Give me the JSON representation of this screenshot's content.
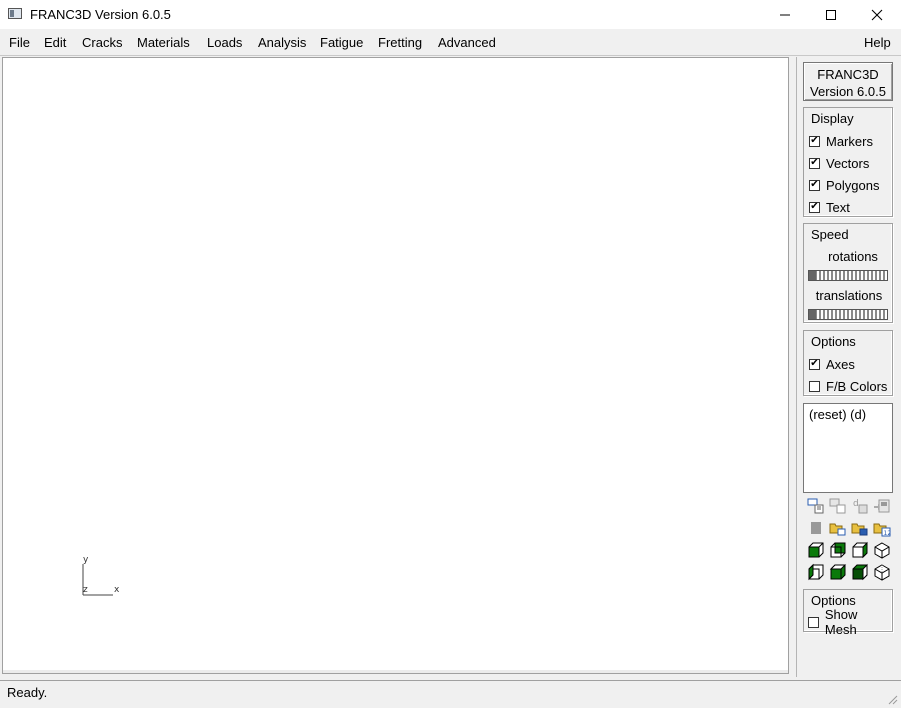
{
  "window": {
    "title": "FRANC3D Version 6.0.5",
    "minimize_glyph": "—",
    "maximize_glyph": "☐",
    "close_glyph": "✕"
  },
  "menu": {
    "items": [
      "File",
      "Edit",
      "Cracks",
      "Materials",
      "Loads",
      "Analysis",
      "Fatigue",
      "Fretting",
      "Advanced"
    ],
    "help": "Help"
  },
  "viewport": {
    "axes": {
      "y": "y",
      "z": "z",
      "x": "x"
    }
  },
  "panel": {
    "version_line1": "FRANC3D",
    "version_line2": "Version 6.0.5",
    "display": {
      "title": "Display",
      "items": [
        {
          "label": "Markers",
          "checked": true
        },
        {
          "label": "Vectors",
          "checked": true
        },
        {
          "label": "Polygons",
          "checked": true
        },
        {
          "label": "Text",
          "checked": true
        }
      ]
    },
    "speed": {
      "title": "Speed",
      "rotations_label": "rotations",
      "translations_label": "translations"
    },
    "options": {
      "title": "Options",
      "items": [
        {
          "label": "Axes",
          "checked": true
        },
        {
          "label": "F/B Colors",
          "checked": false
        }
      ]
    },
    "command_list": {
      "text": "(reset) (d)"
    },
    "tool_icons": [
      "view-transfer-icon",
      "view-copy-icon",
      "view-paste-icon",
      "view-save-icon",
      "disabled-icon",
      "folder-open-icon",
      "folder-load-icon",
      "folder-numbered-icon",
      "cube-front-icon",
      "cube-back-icon",
      "cube-right-icon",
      "cube-iso-icon",
      "cube-left-icon",
      "cube-top-icon",
      "cube-bottom-icon",
      "cube-wire-icon"
    ],
    "options2": {
      "title": "Options",
      "show_mesh": {
        "label": "Show Mesh",
        "checked": false
      }
    },
    "colors": {
      "cube_green": "#0a7a0a",
      "icon_blue": "#2a5db0",
      "icon_yellow": "#e8c040"
    }
  },
  "status": {
    "text": "Ready."
  }
}
